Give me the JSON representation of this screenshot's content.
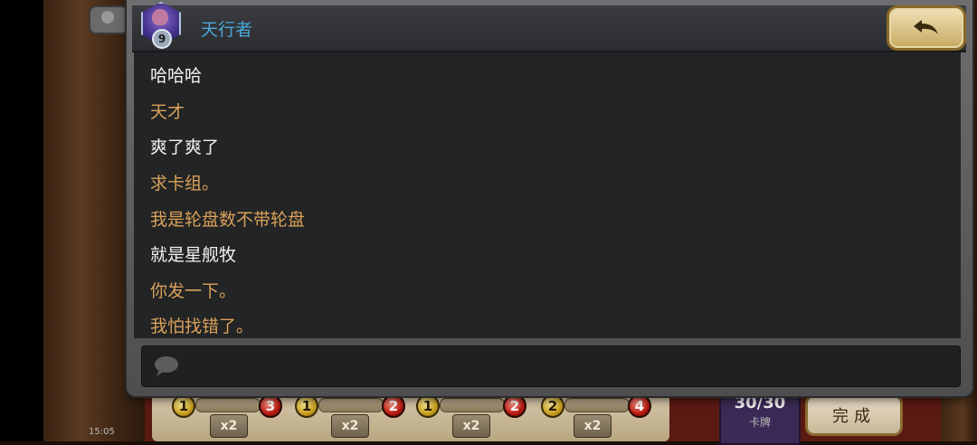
{
  "header": {
    "player_name": "天行者",
    "level": "9"
  },
  "messages": [
    {
      "text": "哈哈哈",
      "role": "self"
    },
    {
      "text": "天才",
      "role": "other"
    },
    {
      "text": "爽了爽了",
      "role": "self"
    },
    {
      "text": "求卡组。",
      "role": "other"
    },
    {
      "text": "我是轮盘数不带轮盘",
      "role": "other"
    },
    {
      "text": "就是星舰牧",
      "role": "self"
    },
    {
      "text": "你发一下。",
      "role": "other"
    },
    {
      "text": "我怕找错了。",
      "role": "other"
    }
  ],
  "background": {
    "cards": [
      {
        "cost": "1",
        "count": "3",
        "label": "x2"
      },
      {
        "cost": "1",
        "count": "2",
        "label": "x2"
      },
      {
        "cost": "1",
        "count": "2",
        "label": "x2"
      },
      {
        "cost": "2",
        "count": "4",
        "label": "x2"
      }
    ],
    "deck_count": "30/30",
    "deck_label": "卡牌",
    "done_label": "完成",
    "clock": "15:05"
  },
  "colors": {
    "self_text": "#f2f2f2",
    "other_text": "#d9a15a",
    "name_text": "#4aa8d8"
  },
  "icons": {
    "back": "back-arrow-icon",
    "input": "speech-bubble-icon",
    "profile": "profile-icon"
  }
}
